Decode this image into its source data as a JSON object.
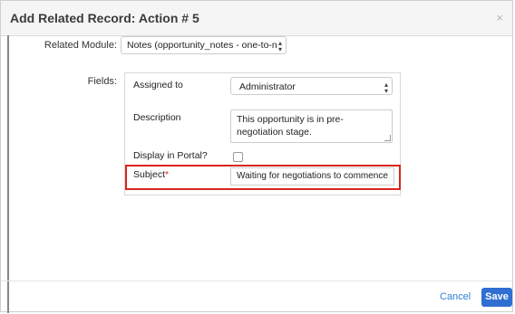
{
  "modal": {
    "title": "Add Related Record: Action # 5",
    "close_glyph": "×"
  },
  "form": {
    "related_module_label": "Related Module:",
    "related_module_value": "Notes (opportunity_notes - one-to-n",
    "fields_label": "Fields:"
  },
  "fields": {
    "assigned_to_label": "Assigned to",
    "assigned_to_value": "Administrator",
    "description_label": "Description",
    "description_value": "This opportunity is in pre-negotiation stage.",
    "display_in_portal_label": "Display in Portal?",
    "display_in_portal_checked": false,
    "subject_label": "Subject",
    "subject_required_mark": "*",
    "subject_value": "Waiting for negotiations to commence"
  },
  "footer": {
    "cancel_label": "Cancel",
    "save_label": "Save"
  },
  "colors": {
    "highlight": "#d9251d",
    "save_button": "#2f6fd1",
    "cancel_link": "#2f7fd6"
  }
}
